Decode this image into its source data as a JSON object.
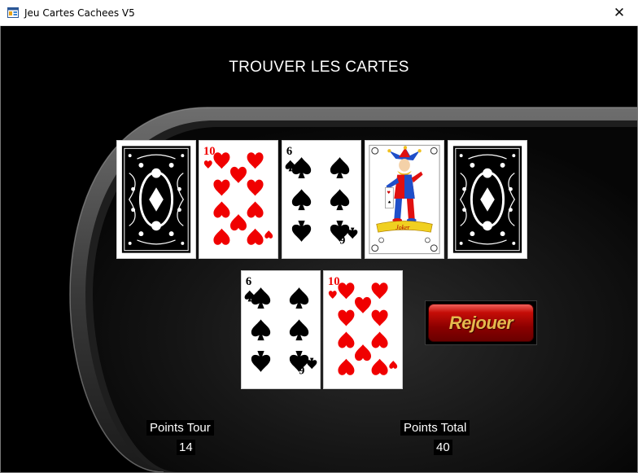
{
  "window": {
    "title": "Jeu Cartes Cachees V5",
    "close_glyph": "✕"
  },
  "game": {
    "heading": "TROUVER LES CARTES"
  },
  "cards_top": [
    {
      "face": "back"
    },
    {
      "face": "up",
      "rank": "10",
      "suit": "hearts"
    },
    {
      "face": "up",
      "rank": "6",
      "suit": "spades"
    },
    {
      "face": "up",
      "rank": "Joker",
      "suit": "joker",
      "banner": "Joker"
    },
    {
      "face": "back"
    }
  ],
  "cards_bottom": [
    {
      "face": "up",
      "rank": "6",
      "suit": "spades"
    },
    {
      "face": "up",
      "rank": "10",
      "suit": "hearts"
    }
  ],
  "buttons": {
    "replay": "Rejouer"
  },
  "score": {
    "round_label": "Points Tour",
    "round_value": "14",
    "total_label": "Points Total",
    "total_value": "40"
  },
  "colors": {
    "hearts": "#f00000",
    "spades": "#000000",
    "button": "#a80000",
    "button_text": "#e4b84d",
    "felt": "#0a0a0a"
  }
}
